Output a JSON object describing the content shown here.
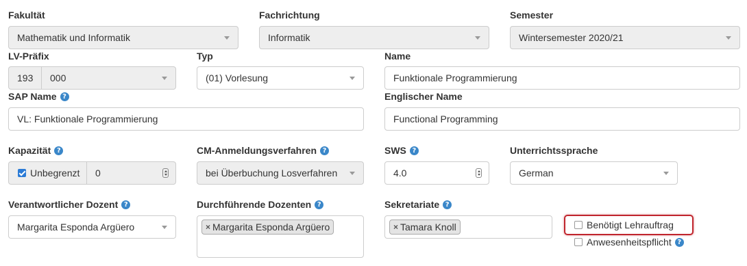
{
  "fakultaet": {
    "label": "Fakultät",
    "value": "Mathematik und Informatik"
  },
  "fachrichtung": {
    "label": "Fachrichtung",
    "value": "Informatik"
  },
  "semester": {
    "label": "Semester",
    "value": "Wintersemester 2020/21"
  },
  "lv_praefix": {
    "label": "LV-Präfix",
    "prefix": "193",
    "value": "000"
  },
  "typ": {
    "label": "Typ",
    "value": "(01) Vorlesung"
  },
  "name": {
    "label": "Name",
    "value": "Funktionale Programmierung"
  },
  "sap_name": {
    "label": "SAP Name",
    "value": "VL: Funktionale Programmierung"
  },
  "englischer_name": {
    "label": "Englischer Name",
    "value": "Functional Programming"
  },
  "kapazitaet": {
    "label": "Kapazität",
    "checkbox_label": "Unbegrenzt",
    "checked": true,
    "value": "0"
  },
  "cm_anmeldung": {
    "label": "CM-Anmeldungsverfahren",
    "value": "bei Überbuchung Losverfahren"
  },
  "sws": {
    "label": "SWS",
    "value": "4.0"
  },
  "unterrichtssprache": {
    "label": "Unterrichtssprache",
    "value": "German"
  },
  "verantwortlicher_dozent": {
    "label": "Verantwortlicher Dozent",
    "value": "Margarita Esponda Argüero"
  },
  "durchfuehrende_dozenten": {
    "label": "Durchführende Dozenten",
    "chips": [
      "Margarita Esponda Argüero"
    ]
  },
  "sekretariate": {
    "label": "Sekretariate",
    "chips": [
      "Tamara Knoll"
    ]
  },
  "checkboxes": {
    "lehrauftrag": {
      "label": "Benötigt Lehrauftrag",
      "checked": false
    },
    "anwesenheit": {
      "label": "Anwesenheitspflicht",
      "checked": false
    }
  },
  "help_glyph": "?",
  "remove_glyph": "×",
  "colors": {
    "highlight": "#c0252d",
    "help": "#3a87c9",
    "checkbox_on": "#2b7bd6"
  }
}
